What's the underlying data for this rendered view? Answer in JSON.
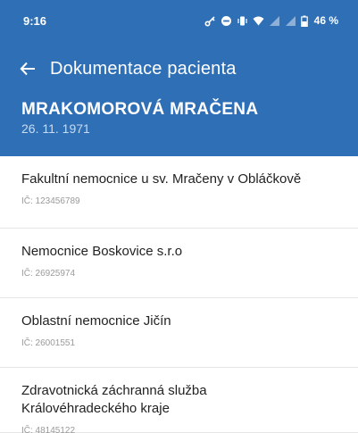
{
  "status_bar": {
    "time": "9:16",
    "battery": "46 %",
    "icons": [
      "key-icon",
      "do-not-disturb-icon",
      "vibrate-icon",
      "wifi-icon",
      "signal-icon",
      "signal-icon",
      "battery-icon"
    ]
  },
  "toolbar": {
    "back_icon": "arrow-left-icon",
    "title": "Dokumentace pacienta"
  },
  "patient": {
    "name": "MRAKOMOROVÁ MRAČENA",
    "dob": "26. 11. 1971"
  },
  "providers": [
    {
      "name": "Fakultní nemocnice u sv. Mračeny v Obláčkově",
      "ic": "IČ: 123456789"
    },
    {
      "name": "Nemocnice Boskovice s.r.o",
      "ic": "IČ: 26925974"
    },
    {
      "name": "Oblastní nemocnice Jičín",
      "ic": "IČ: 26001551"
    },
    {
      "name": "Zdravotnická záchranná služba Královéhradeckého kraje",
      "ic": "IČ: 48145122"
    }
  ],
  "colors": {
    "header_background": "#2f6fb6",
    "header_text": "#ffffff",
    "divider": "#e6e6e6"
  }
}
